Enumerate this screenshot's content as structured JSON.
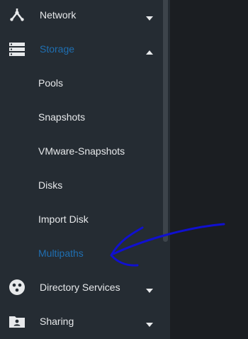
{
  "sidebar": {
    "items": [
      {
        "label": "Network",
        "icon": "network-icon",
        "expanded": false
      },
      {
        "label": "Storage",
        "icon": "storage-icon",
        "expanded": true,
        "active": true,
        "children": [
          {
            "label": "Pools"
          },
          {
            "label": "Snapshots"
          },
          {
            "label": "VMware-Snapshots"
          },
          {
            "label": "Disks"
          },
          {
            "label": "Import Disk"
          },
          {
            "label": "Multipaths",
            "active": true
          }
        ]
      },
      {
        "label": "Directory Services",
        "icon": "directory-services-icon",
        "expanded": false
      },
      {
        "label": "Sharing",
        "icon": "sharing-folder-icon",
        "expanded": false
      }
    ]
  },
  "colors": {
    "sidebar_bg": "#252c33",
    "main_bg": "#1b1e22",
    "text": "#e7e9eb",
    "active": "#1f6fb2",
    "annotation_arrow": "#1010d0"
  }
}
